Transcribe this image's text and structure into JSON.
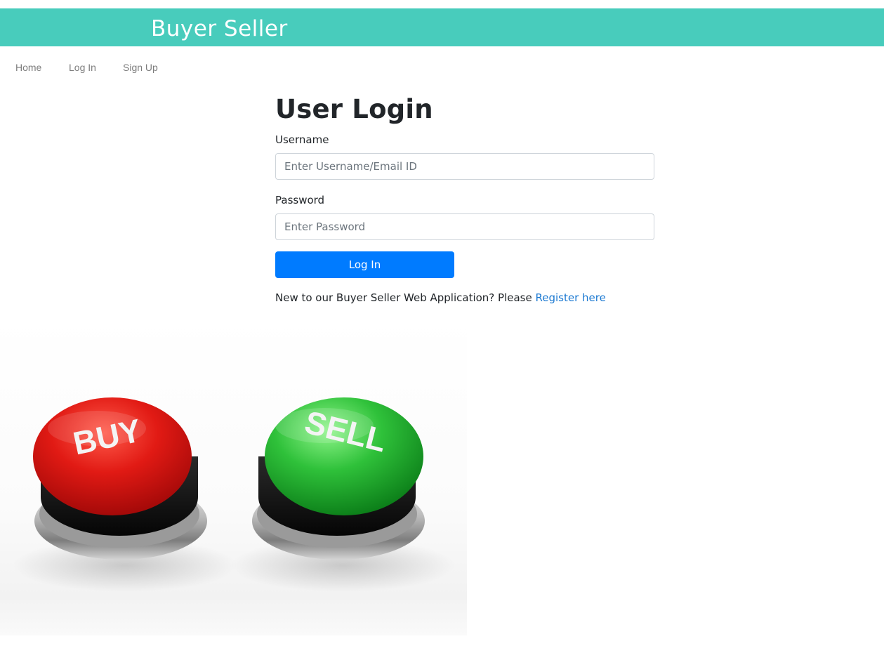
{
  "brand": {
    "title": "Buyer Seller",
    "color": "#48ccbc"
  },
  "nav": {
    "items": [
      {
        "label": "Home"
      },
      {
        "label": "Log In"
      },
      {
        "label": "Sign Up"
      }
    ]
  },
  "login": {
    "title": "User Login",
    "username_label": "Username",
    "username_placeholder": "Enter Username/Email ID",
    "password_label": "Password",
    "password_placeholder": "Enter Password",
    "submit_label": "Log In",
    "submit_color": "#007bff",
    "register_prompt": "New to our Buyer Seller Web Application? Please ",
    "register_link": "Register here"
  },
  "hero": {
    "buy_label": "BUY",
    "sell_label": "SELL",
    "buy_color": "#d91a1a",
    "sell_color": "#2fc13a"
  }
}
